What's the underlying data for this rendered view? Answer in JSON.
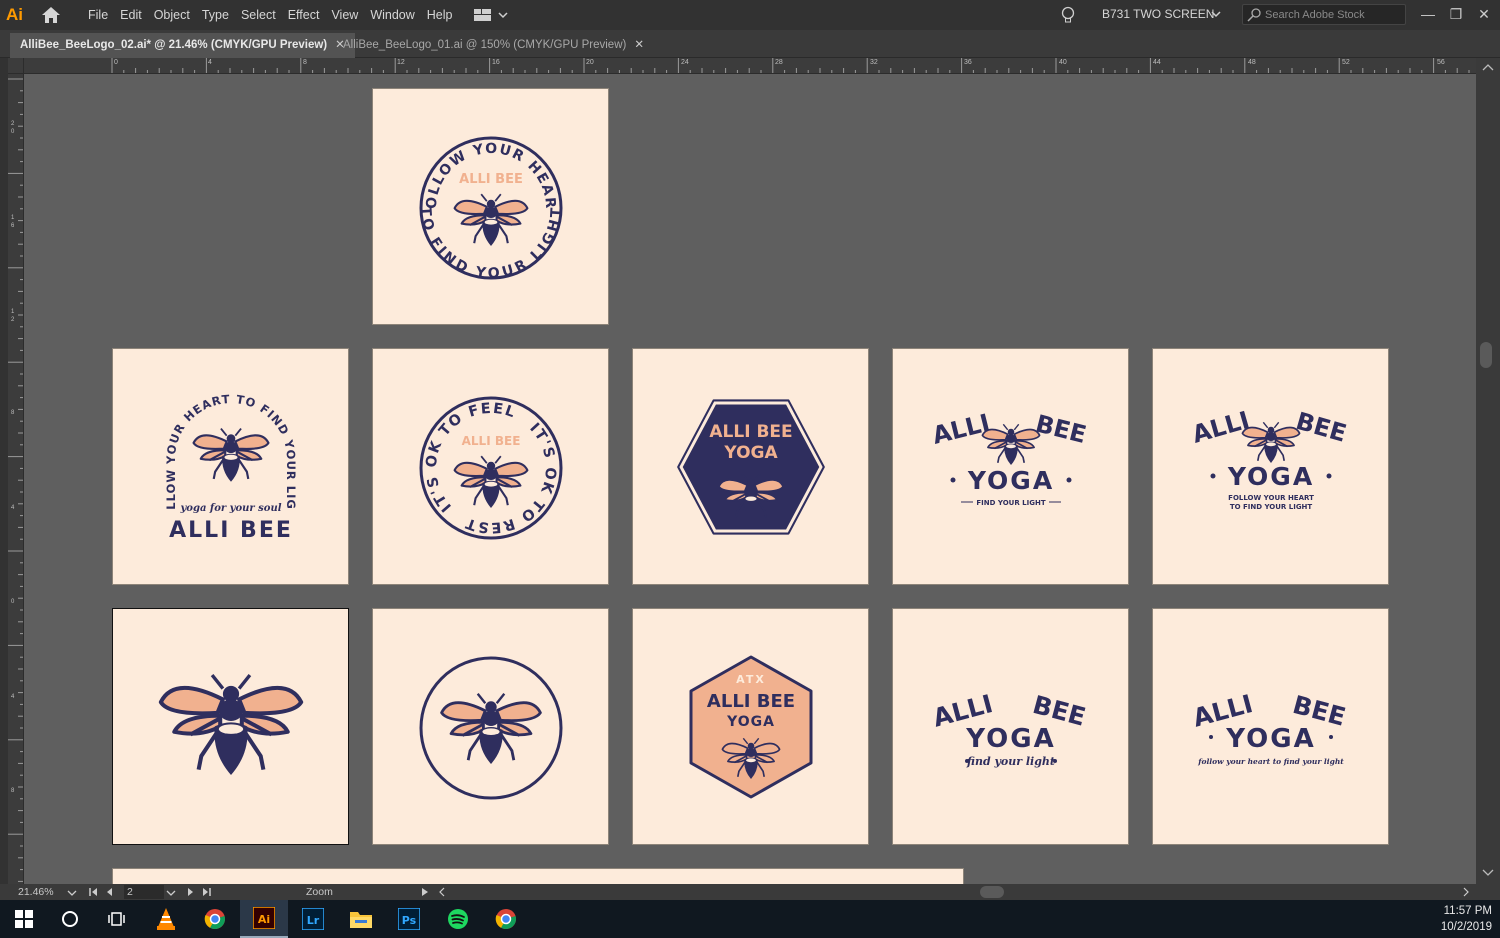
{
  "app": {
    "logo": "Ai",
    "menus": [
      "File",
      "Edit",
      "Object",
      "Type",
      "Select",
      "Effect",
      "View",
      "Window",
      "Help"
    ],
    "workspace": "B731 TWO SCREEN",
    "search_placeholder": "Search Adobe Stock",
    "window_controls": [
      "—",
      "❐",
      "✕"
    ]
  },
  "tabs": [
    {
      "label": "AlliBee_BeeLogo_02.ai* @ 21.46% (CMYK/GPU Preview)",
      "active": true
    },
    {
      "label": "AlliBee_BeeLogo_01.ai @ 150% (CMYK/GPU Preview)",
      "active": false
    }
  ],
  "ruler": {
    "h_labels": [
      "0",
      "4",
      "8",
      "12",
      "16",
      "20",
      "24",
      "28",
      "32",
      "36",
      "40",
      "44",
      "48",
      "52",
      "56"
    ],
    "v_labels": [
      "2 0",
      "1 6",
      "1 2",
      "8",
      "4",
      "0",
      "4",
      "8"
    ]
  },
  "artboards": {
    "logo_texts": {
      "follow_heart": "FOLLOW YOUR HEART",
      "find_light": "TO FIND YOUR LIGHT",
      "alli_bee": "ALLI BEE",
      "arc_heart_find": "FOLLOW YOUR HEART TO FIND YOUR LIGHT",
      "yoga_soul": "yoga for your soul",
      "its_ok_feel": "IT'S OK TO FEEL",
      "its_ok_rest": "IT'S OK TO REST",
      "alli_bee_yoga": "ALLI BEE YOGA",
      "alli": "ALLI",
      "bee": "BEE",
      "yoga": "YOGA",
      "find_your_light_caps": "FIND YOUR LIGHT",
      "follow_heart_small": "FOLLOW YOUR HEART",
      "to_find_light_small": "TO FIND YOUR LIGHT",
      "atx": "ATX",
      "find_light_script": "find your light",
      "follow_heart_script": "follow your heart to find your light"
    }
  },
  "status": {
    "zoom": "21.46%",
    "page": "2",
    "tool": "Zoom"
  },
  "taskbar": {
    "time": "11:57 PM",
    "date": "10/2/2019",
    "apps": [
      "windows-start",
      "cortana",
      "task-view",
      "vlc",
      "chrome",
      "illustrator",
      "lightroom",
      "file-explorer",
      "photoshop",
      "spotify",
      "chrome"
    ]
  },
  "colors": {
    "navy": "#2f2e5e",
    "peach": "#f1b18f",
    "cream": "#fdebdb",
    "ai_orange": "#ff9a00"
  }
}
